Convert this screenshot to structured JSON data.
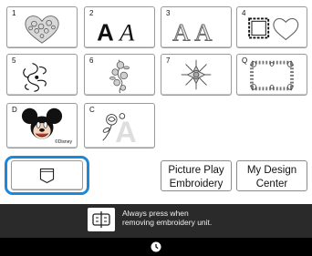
{
  "categories": [
    {
      "label": "1",
      "icon": "floral-heart-icon"
    },
    {
      "label": "2",
      "icon": "script-font-icon",
      "glyph": "A𝓐"
    },
    {
      "label": "3",
      "icon": "outline-font-icon",
      "glyph": "AA"
    },
    {
      "label": "4",
      "icon": "frame-shapes-icon"
    },
    {
      "label": "5",
      "icon": "ribbon-motif-icon"
    },
    {
      "label": "6",
      "icon": "floral-vine-icon"
    },
    {
      "label": "7",
      "icon": "snowflake-icon"
    },
    {
      "label": "Q",
      "icon": "quilt-border-icon"
    },
    {
      "label": "D",
      "icon": "mickey-mouse-icon",
      "caption": "©Disney"
    },
    {
      "label": "C",
      "icon": "rose-monogram-icon",
      "glyph": "A"
    }
  ],
  "buttons": {
    "picture_play": "Picture Play\nEmbroidery",
    "my_design": "My Design\nCenter"
  },
  "status_message": "Always press when\nremoving embroidery unit.",
  "colors": {
    "focus": "#1e88d8",
    "dark_bar": "#2a2a2a"
  }
}
